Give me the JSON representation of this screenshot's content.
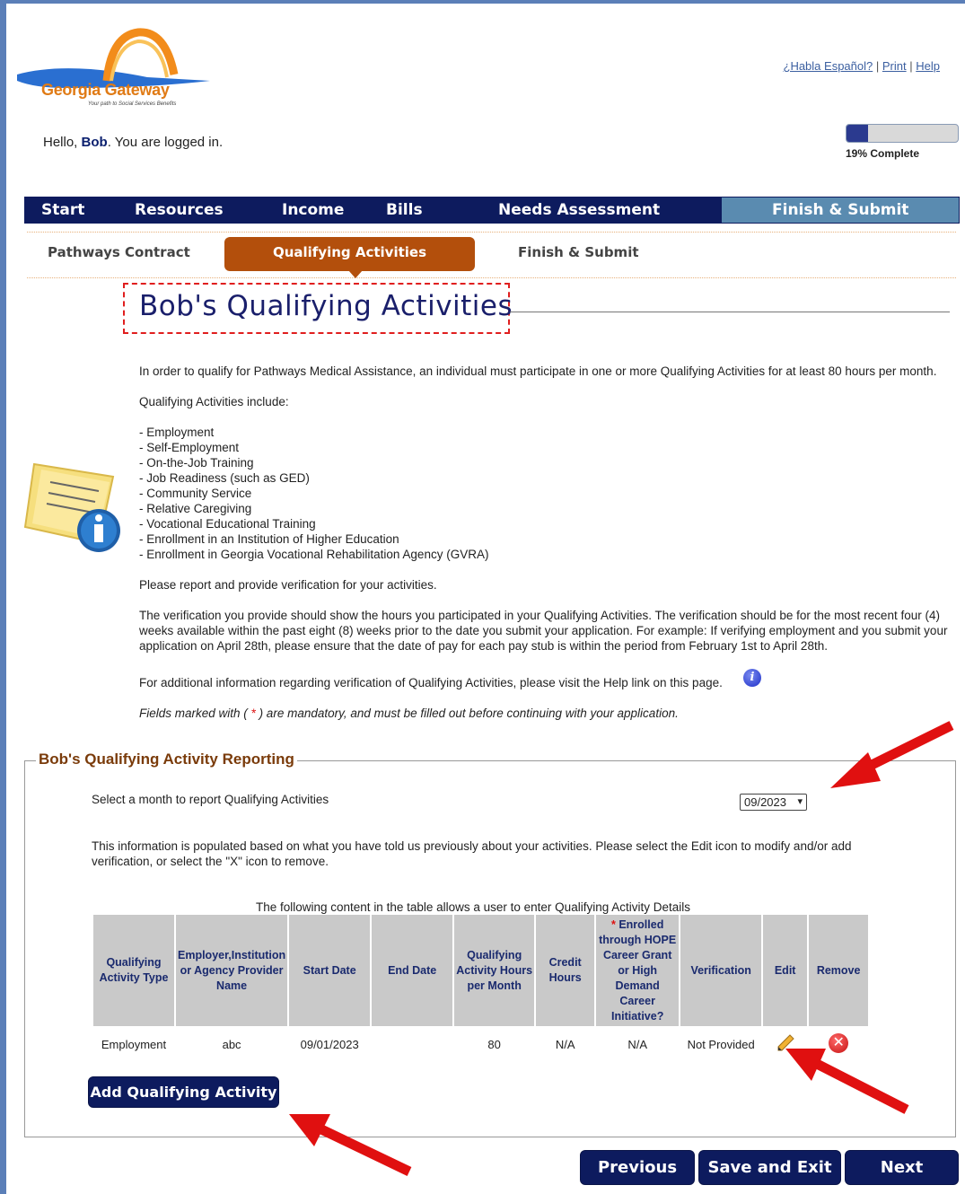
{
  "header": {
    "logo_text": "Georgia Gateway",
    "logo_tagline": "Your path to Social Services Benefits",
    "links": [
      "¿Habla Español?",
      "Print",
      "Help"
    ],
    "link_separator": "|",
    "greeting_prefix": "Hello, ",
    "user_name": "Bob",
    "greeting_suffix": ". You are logged in.",
    "progress": {
      "percent": 19,
      "label": "19% Complete"
    }
  },
  "main_nav": {
    "items": [
      "Start",
      "Resources",
      "Income",
      "Bills",
      "Needs Assessment",
      "Finish & Submit"
    ],
    "active": "Finish & Submit"
  },
  "sub_nav": {
    "items": [
      "Pathways Contract",
      "Qualifying Activities",
      "Finish & Submit"
    ],
    "active": "Qualifying Activities"
  },
  "page": {
    "title": "Bob's Qualifying Activities",
    "intro": "In order to qualify for Pathways Medical Assistance, an individual must participate in one or more Qualifying Activities for at least 80 hours per month.",
    "list_heading": "Qualifying Activities include:",
    "activities": [
      "- Employment",
      "- Self-Employment",
      "- On-the-Job Training",
      "- Job Readiness (such as GED)",
      "- Community Service",
      "- Relative Caregiving",
      "- Vocational Educational Training",
      "- Enrollment in an Institution of Higher Education",
      "- Enrollment in Georgia Vocational Rehabilitation Agency (GVRA)"
    ],
    "report_text": "Please report and provide verification for your activities.",
    "verification_text": "The verification you provide should show the hours you participated in your Qualifying Activities. The verification should be for the most recent four (4) weeks available within the past eight (8) weeks prior to the date you submit your application. For example: If verifying employment and you submit your application on April 28th, please ensure that the date of pay for each pay stub is within the period from February 1st to April 28th.",
    "help_text": "For additional information regarding verification of Qualifying Activities, please visit the Help link on this page.",
    "mandatory_prefix": "Fields marked with ( ",
    "mandatory_star": "*",
    "mandatory_suffix": " ) are mandatory, and must be filled out before continuing with your application."
  },
  "reporting": {
    "legend": "Bob's Qualifying Activity Reporting",
    "month_label": "Select a month to report Qualifying Activities",
    "month_value": "09/2023",
    "info": "This information is populated based on what you have told us previously about your activities. Please select the Edit icon to modify and/or add verification, or select the \"X\" icon to remove.",
    "table_caption": "The following content in the table allows a user to enter Qualifying Activity Details",
    "columns": [
      "Qualifying Activity Type",
      "Employer,Institution or Agency Provider Name",
      "Start Date",
      "End Date",
      "Qualifying Activity Hours per Month",
      "Credit Hours",
      "Enrolled through HOPE Career Grant or High Demand Career Initiative?",
      "Verification",
      "Edit",
      "Remove"
    ],
    "rows": [
      [
        "Employment",
        "abc",
        "09/01/2023",
        "",
        "80",
        "N/A",
        "N/A",
        "Not Provided"
      ]
    ],
    "add_button": "Add Qualifying Activity"
  },
  "footer_buttons": {
    "previous": "Previous",
    "save_exit": "Save and Exit",
    "next": "Next"
  },
  "colors": {
    "nav": "#0d1b5e",
    "active_tab": "#b34f0c",
    "finish_tab": "#5a8bb0",
    "arrows": "#e01010"
  }
}
